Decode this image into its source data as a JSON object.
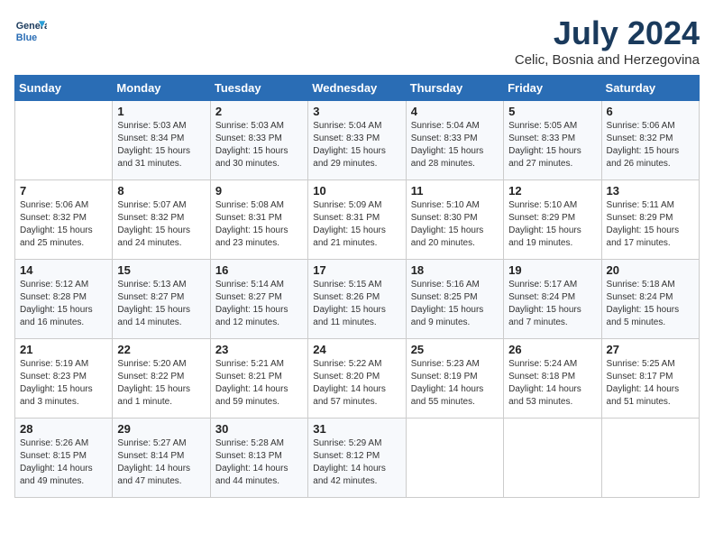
{
  "header": {
    "logo_line1": "General",
    "logo_line2": "Blue",
    "month_title": "July 2024",
    "location": "Celic, Bosnia and Herzegovina"
  },
  "weekdays": [
    "Sunday",
    "Monday",
    "Tuesday",
    "Wednesday",
    "Thursday",
    "Friday",
    "Saturday"
  ],
  "weeks": [
    [
      {
        "day": "",
        "info": ""
      },
      {
        "day": "1",
        "info": "Sunrise: 5:03 AM\nSunset: 8:34 PM\nDaylight: 15 hours\nand 31 minutes."
      },
      {
        "day": "2",
        "info": "Sunrise: 5:03 AM\nSunset: 8:33 PM\nDaylight: 15 hours\nand 30 minutes."
      },
      {
        "day": "3",
        "info": "Sunrise: 5:04 AM\nSunset: 8:33 PM\nDaylight: 15 hours\nand 29 minutes."
      },
      {
        "day": "4",
        "info": "Sunrise: 5:04 AM\nSunset: 8:33 PM\nDaylight: 15 hours\nand 28 minutes."
      },
      {
        "day": "5",
        "info": "Sunrise: 5:05 AM\nSunset: 8:33 PM\nDaylight: 15 hours\nand 27 minutes."
      },
      {
        "day": "6",
        "info": "Sunrise: 5:06 AM\nSunset: 8:32 PM\nDaylight: 15 hours\nand 26 minutes."
      }
    ],
    [
      {
        "day": "7",
        "info": "Sunrise: 5:06 AM\nSunset: 8:32 PM\nDaylight: 15 hours\nand 25 minutes."
      },
      {
        "day": "8",
        "info": "Sunrise: 5:07 AM\nSunset: 8:32 PM\nDaylight: 15 hours\nand 24 minutes."
      },
      {
        "day": "9",
        "info": "Sunrise: 5:08 AM\nSunset: 8:31 PM\nDaylight: 15 hours\nand 23 minutes."
      },
      {
        "day": "10",
        "info": "Sunrise: 5:09 AM\nSunset: 8:31 PM\nDaylight: 15 hours\nand 21 minutes."
      },
      {
        "day": "11",
        "info": "Sunrise: 5:10 AM\nSunset: 8:30 PM\nDaylight: 15 hours\nand 20 minutes."
      },
      {
        "day": "12",
        "info": "Sunrise: 5:10 AM\nSunset: 8:29 PM\nDaylight: 15 hours\nand 19 minutes."
      },
      {
        "day": "13",
        "info": "Sunrise: 5:11 AM\nSunset: 8:29 PM\nDaylight: 15 hours\nand 17 minutes."
      }
    ],
    [
      {
        "day": "14",
        "info": "Sunrise: 5:12 AM\nSunset: 8:28 PM\nDaylight: 15 hours\nand 16 minutes."
      },
      {
        "day": "15",
        "info": "Sunrise: 5:13 AM\nSunset: 8:27 PM\nDaylight: 15 hours\nand 14 minutes."
      },
      {
        "day": "16",
        "info": "Sunrise: 5:14 AM\nSunset: 8:27 PM\nDaylight: 15 hours\nand 12 minutes."
      },
      {
        "day": "17",
        "info": "Sunrise: 5:15 AM\nSunset: 8:26 PM\nDaylight: 15 hours\nand 11 minutes."
      },
      {
        "day": "18",
        "info": "Sunrise: 5:16 AM\nSunset: 8:25 PM\nDaylight: 15 hours\nand 9 minutes."
      },
      {
        "day": "19",
        "info": "Sunrise: 5:17 AM\nSunset: 8:24 PM\nDaylight: 15 hours\nand 7 minutes."
      },
      {
        "day": "20",
        "info": "Sunrise: 5:18 AM\nSunset: 8:24 PM\nDaylight: 15 hours\nand 5 minutes."
      }
    ],
    [
      {
        "day": "21",
        "info": "Sunrise: 5:19 AM\nSunset: 8:23 PM\nDaylight: 15 hours\nand 3 minutes."
      },
      {
        "day": "22",
        "info": "Sunrise: 5:20 AM\nSunset: 8:22 PM\nDaylight: 15 hours\nand 1 minute."
      },
      {
        "day": "23",
        "info": "Sunrise: 5:21 AM\nSunset: 8:21 PM\nDaylight: 14 hours\nand 59 minutes."
      },
      {
        "day": "24",
        "info": "Sunrise: 5:22 AM\nSunset: 8:20 PM\nDaylight: 14 hours\nand 57 minutes."
      },
      {
        "day": "25",
        "info": "Sunrise: 5:23 AM\nSunset: 8:19 PM\nDaylight: 14 hours\nand 55 minutes."
      },
      {
        "day": "26",
        "info": "Sunrise: 5:24 AM\nSunset: 8:18 PM\nDaylight: 14 hours\nand 53 minutes."
      },
      {
        "day": "27",
        "info": "Sunrise: 5:25 AM\nSunset: 8:17 PM\nDaylight: 14 hours\nand 51 minutes."
      }
    ],
    [
      {
        "day": "28",
        "info": "Sunrise: 5:26 AM\nSunset: 8:15 PM\nDaylight: 14 hours\nand 49 minutes."
      },
      {
        "day": "29",
        "info": "Sunrise: 5:27 AM\nSunset: 8:14 PM\nDaylight: 14 hours\nand 47 minutes."
      },
      {
        "day": "30",
        "info": "Sunrise: 5:28 AM\nSunset: 8:13 PM\nDaylight: 14 hours\nand 44 minutes."
      },
      {
        "day": "31",
        "info": "Sunrise: 5:29 AM\nSunset: 8:12 PM\nDaylight: 14 hours\nand 42 minutes."
      },
      {
        "day": "",
        "info": ""
      },
      {
        "day": "",
        "info": ""
      },
      {
        "day": "",
        "info": ""
      }
    ]
  ]
}
